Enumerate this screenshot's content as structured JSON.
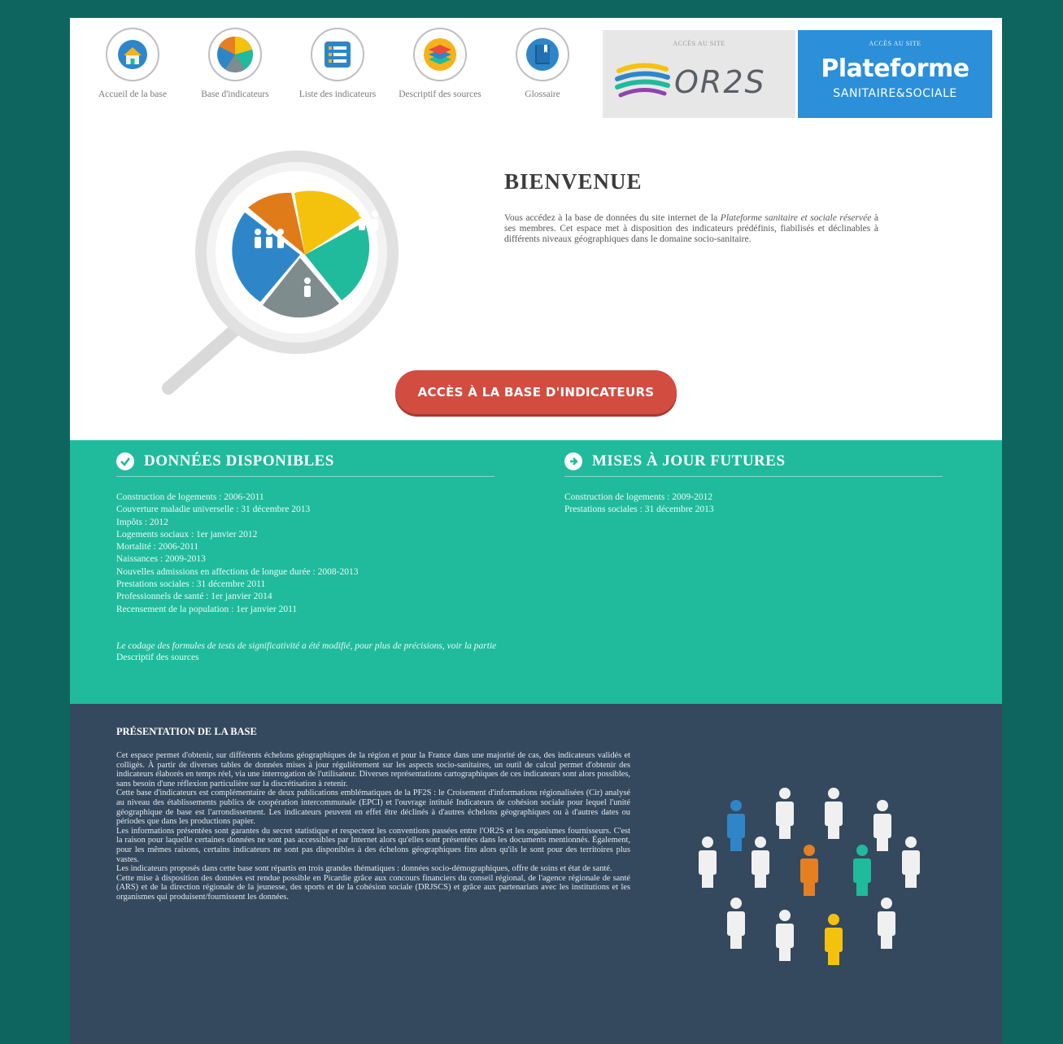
{
  "nav": {
    "items": [
      {
        "label": "Accueil de la base",
        "icon": "home-icon"
      },
      {
        "label": "Base d'indicateurs",
        "icon": "pie-chart-icon"
      },
      {
        "label": "Liste des indicateurs",
        "icon": "list-icon"
      },
      {
        "label": "Descriptif des sources",
        "icon": "layers-icon"
      },
      {
        "label": "Glossaire",
        "icon": "book-icon"
      }
    ]
  },
  "partners": {
    "or2s": {
      "caption": "ACCÈS AU SITE",
      "name": "OR2S"
    },
    "pss": {
      "caption": "ACCÈS AU SITE",
      "name_line1": "Plateforme",
      "name_line2": "SANITAIRE&SOCIALE"
    }
  },
  "welcome": {
    "title": "BIENVENUE",
    "text_before": "Vous accédez à la base de données du site internet de la ",
    "text_italic": "Plateforme sanitaire et sociale réservée",
    "text_after": " à ses membres. Cet espace met à disposition des indicateurs prédéfinis, fiabilisés et déclinables à différents niveaux géographiques dans le domaine socio-sanitaire.",
    "cta_label": "ACCÈS À LA BASE D'INDICATEURS"
  },
  "available": {
    "title": "DONNÉES DISPONIBLES",
    "items": [
      "Construction de logements : 2006-2011",
      "Couverture maladie universelle : 31 décembre 2013",
      "Impôts : 2012",
      "Logements sociaux : 1er janvier 2012",
      "Mortalité : 2006-2011",
      "Naissances : 2009-2013",
      "Nouvelles admissions en affections de longue durée : 2008-2013",
      "Prestations sociales : 31 décembre 2011",
      "Professionnels de santé : 1er janvier 2014",
      "Recensement de la population : 1er janvier 2011"
    ],
    "note_italic": "Le codage des formules de tests de significativité a été modifié, pour plus de précisions, voir la partie ",
    "note_plain": "Descriptif des sources"
  },
  "future": {
    "title": "MISES À JOUR FUTURES",
    "items": [
      "Construction de logements : 2009-2012",
      "Prestations sociales : 31 décembre 2013"
    ]
  },
  "presentation": {
    "title": "PRÉSENTATION DE LA BASE",
    "paragraphs": [
      "Cet espace permet d'obtenir, sur différents échelons géographiques de la région et pour la France dans une majorité de cas, des indicateurs validés et colligés. À partir de diverses tables de données mises à jour régulièrement sur les aspects socio-sanitaires, un outil de calcul permet d'obtenir des indicateurs élaborés en temps réel, via une interrogation de l'utilisateur. Diverses représentations cartographiques de ces indicateurs sont alors possibles, sans besoin d'une réflexion particulière sur la discrétisation à retenir.",
      "Cette base d'indicateurs est complémentaire de deux publications emblématiques de la PF2S : le Croisement d'informations régionalisées (Cir) analysé au niveau des établissements publics de coopération intercommunale (EPCI) et l'ouvrage intitulé Indicateurs de cohésion sociale pour lequel l'unité géographique de base est l'arrondissement. Les indicateurs peuvent en effet être déclinés à d'autres échelons géographiques ou à d'autres dates ou périodes que dans les productions papier.",
      "Les informations présentées sont garantes du secret statistique et respectent les conventions passées entre l'OR2S et les organismes fournisseurs. C'est la raison pour laquelle certaines données ne sont pas accessibles par Internet alors qu'elles sont présentées dans les documents mentionnés. Également, pour les mêmes raisons, certains indicateurs ne sont pas disponibles à des échelons géographiques fins alors qu'ils le sont pour des territoires plus vastes.",
      "Les indicateurs proposés dans cette base sont répartis en trois grandes thématiques : données socio-démographiques, offre de soins et état de santé.",
      "Cette mise à disposition des données est rendue possible en Picardie grâce aux concours financiers du conseil régional, de l'agence régionale de santé (ARS) et de la direction régionale de la jeunesse, des sports et de la cohésion sociale (DRJSCS) et grâce aux partenariats avec les institutions et les organismes qui produisent/fournissent les données."
    ]
  },
  "colors": {
    "teal_dark": "#0e6560",
    "green": "#1fbb9c",
    "navy": "#34495e",
    "cta": "#d24c40",
    "pss_blue": "#2b8fda"
  }
}
